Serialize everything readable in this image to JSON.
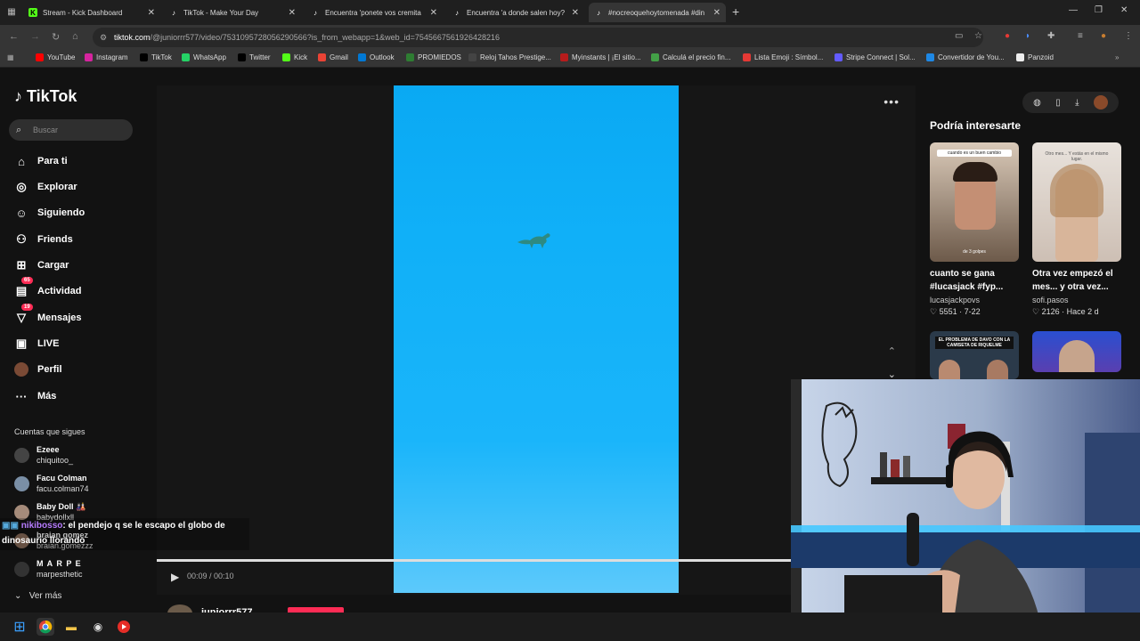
{
  "browser": {
    "tabs": [
      {
        "title": "Stream - Kick Dashboard",
        "icon": "kick-icon",
        "active": false
      },
      {
        "title": "TikTok - Make Your Day",
        "icon": "tiktok-icon",
        "active": false
      },
      {
        "title": "Encuentra 'ponete vos cremita",
        "icon": "tiktok-icon",
        "active": false
      },
      {
        "title": "Encuentra 'a donde salen hoy?",
        "icon": "tiktok-icon",
        "active": false
      },
      {
        "title": "#nocreoquehoytomenada #din",
        "icon": "tiktok-icon",
        "active": true
      }
    ],
    "url_host": "tiktok.com",
    "url_path": "/@juniorrr577/video/7531095728056290566?is_from_webapp=1&web_id=7545667561926428216",
    "bookmarks": [
      {
        "label": "YouTube",
        "color": "#ff0000"
      },
      {
        "label": "Instagram",
        "color": "#d6249f"
      },
      {
        "label": "TikTok",
        "color": "#000000"
      },
      {
        "label": "WhatsApp",
        "color": "#25d366"
      },
      {
        "label": "Twitter",
        "color": "#000000"
      },
      {
        "label": "Kick",
        "color": "#53fc18"
      },
      {
        "label": "Gmail",
        "color": "#ea4335"
      },
      {
        "label": "Outlook",
        "color": "#0078d4"
      },
      {
        "label": "PROMIEDOS",
        "color": "#2e7d32"
      },
      {
        "label": "Reloj Tahos Prestige...",
        "color": "#444444"
      },
      {
        "label": "Myinstants | ¡El sitio...",
        "color": "#b71c1c"
      },
      {
        "label": "Calculá el precio fin...",
        "color": "#43a047"
      },
      {
        "label": "Lista Emoji : Símbol...",
        "color": "#e53935"
      },
      {
        "label": "Stripe Connect | Sol...",
        "color": "#635bff"
      },
      {
        "label": "Convertidor de You...",
        "color": "#1e88e5"
      },
      {
        "label": "Panzoid",
        "color": "#eeeeee"
      }
    ]
  },
  "tiktok": {
    "logo": "TikTok",
    "search_placeholder": "Buscar",
    "nav": [
      {
        "label": "Para ti",
        "icon": "home-icon",
        "badge": ""
      },
      {
        "label": "Explorar",
        "icon": "compass-icon",
        "badge": ""
      },
      {
        "label": "Siguiendo",
        "icon": "following-icon",
        "badge": ""
      },
      {
        "label": "Friends",
        "icon": "friends-icon",
        "badge": ""
      },
      {
        "label": "Cargar",
        "icon": "upload-icon",
        "badge": ""
      },
      {
        "label": "Actividad",
        "icon": "activity-icon",
        "badge": "65"
      },
      {
        "label": "Mensajes",
        "icon": "messages-icon",
        "badge": "19"
      },
      {
        "label": "LIVE",
        "icon": "live-icon",
        "badge": ""
      },
      {
        "label": "Perfil",
        "icon": "profile-icon",
        "badge": ""
      },
      {
        "label": "Más",
        "icon": "more-icon",
        "badge": ""
      }
    ],
    "following_header": "Cuentas que sigues",
    "accounts": [
      {
        "name": "Ezeee",
        "handle": "chiquitoo_"
      },
      {
        "name": "Facu Colman",
        "handle": "facu.colman74"
      },
      {
        "name": "Baby Doll 🎎",
        "handle": "babydollxll"
      },
      {
        "name": "braian gomez",
        "handle": "braian.gomezzz"
      },
      {
        "name": "M A R P E",
        "handle": "marpesthetic"
      }
    ],
    "see_more": "Ver más",
    "video": {
      "time": "00:09 / 00:10",
      "progress": 0.9,
      "author": "juniorrr577"
    },
    "suggestions_title": "Podría interesarte",
    "suggestions": [
      {
        "title": "cuanto se gana #lucasjack #fyp...",
        "user": "lucasjackpovs",
        "likes": "5551",
        "date": "7-22",
        "caption": "cuando es un buen cambio",
        "sub": "de 3 golpes"
      },
      {
        "title": "Otra vez empezó el mes... y otra vez...",
        "user": "sofi.pasos",
        "likes": "2126",
        "date": "Hace 2 d",
        "caption": "Otro mes... Y estás en el mismo lugar.",
        "sub": ""
      },
      {
        "title": "",
        "user": "",
        "likes": "",
        "date": "",
        "caption": "EL PROBLEMA DE DAVO CON LA CAMISETA DE RIQUELME",
        "sub": ""
      },
      {
        "title": "",
        "user": "",
        "likes": "",
        "date": "",
        "caption": "",
        "sub": ""
      }
    ]
  },
  "overlay": {
    "chat_user": "nikibosso",
    "chat_text": "el pendejo q se le escapo el globo de dinosaurio llorando"
  },
  "taskbar": {
    "apps": [
      "windows-icon",
      "chrome-icon",
      "explorer-icon",
      "obs-icon",
      "youtube-icon"
    ]
  }
}
